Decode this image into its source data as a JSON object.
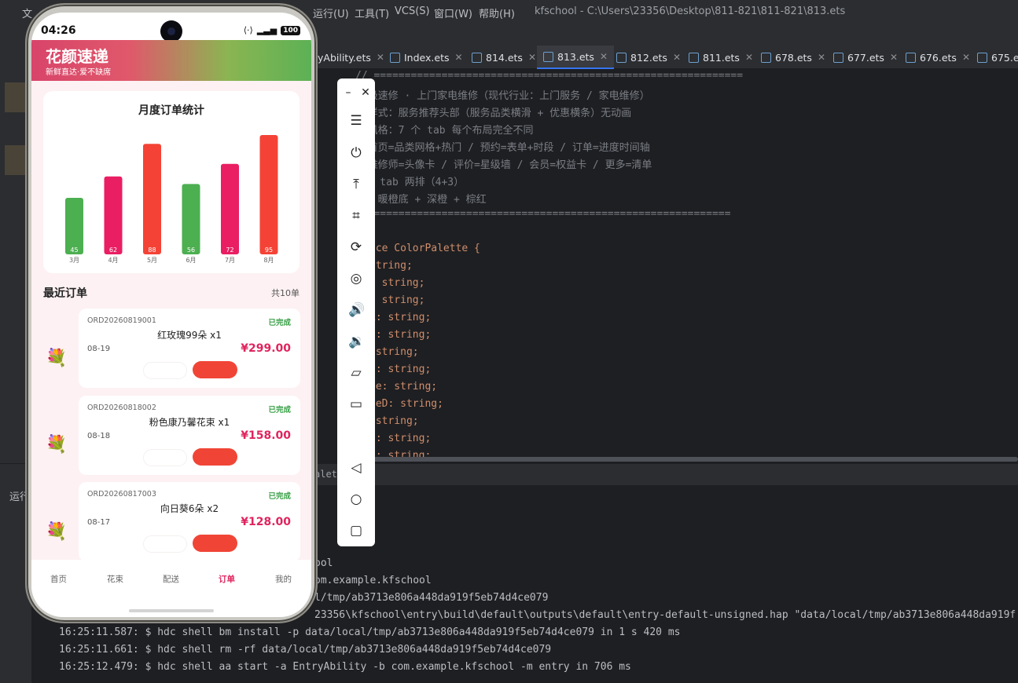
{
  "ide": {
    "menu": [
      "文",
      "运行(U)",
      "工具(T)",
      "VCS(S)",
      "窗口(W)",
      "帮助(H)"
    ],
    "title": "kfschool - C:\\Users\\23356\\Desktop\\811-821\\811-821\\813.ets",
    "tabs": [
      "yAbility.ets",
      "Index.ets",
      "814.ets",
      "813.ets",
      "812.ets",
      "811.ets",
      "678.ets",
      "677.ets",
      "676.ets",
      "675.et"
    ],
    "code_lines": [
      {
        "t": "// ============================================================",
        "c": "cmt"
      },
      {
        "t": "  极速修 · 上门家电维修（现代行业：上门服务 / 家电维修）",
        "c": "cmt"
      },
      {
        "t": "  样式：服务推荐头部（服务品类横滑 + 优惠横条）无动画",
        "c": "cmt"
      },
      {
        "t": "  风格：7 个 tab 每个布局完全不同",
        "c": "cmt"
      },
      {
        "t": "  首页=品类网格+热门 / 预约=表单+时段 / 订单=进度时间轴",
        "c": "cmt"
      },
      {
        "t": "  维修师=头像卡 / 评价=星级墙 / 会员=权益卡 / 更多=清单",
        "c": "cmt"
      },
      {
        "t": "  7 tab 两排（4+3）",
        "c": "cmt"
      },
      {
        "t": "  ：暖橙底 + 深橙 + 棕红",
        "c": "cmt"
      },
      {
        "t": "=============================================================",
        "c": "cmt"
      },
      {
        "t": "",
        "c": "id"
      },
      {
        "t": "ace ColorPalette {",
        "c": "kw"
      },
      {
        "t": "string;",
        "c": "ty"
      },
      {
        "t": ": string;",
        "c": "ty"
      },
      {
        "t": ": string;",
        "c": "ty"
      },
      {
        "t": "L: string;",
        "c": "ty"
      },
      {
        "t": "e: string;",
        "c": "ty"
      },
      {
        "t": " string;",
        "c": "ty"
      },
      {
        "t": "3: string;",
        "c": "ty"
      },
      {
        "t": "ge: string;",
        "c": "ty"
      },
      {
        "t": "geD: string;",
        "c": "ty"
      },
      {
        "t": " string;",
        "c": "ty"
      },
      {
        "t": "n: string;",
        "c": "ty"
      },
      {
        "t": "n: string;",
        "c": "ty"
      }
    ],
    "run_label": "运行",
    "editor_hint": "alette",
    "console": [
      "ool",
      "om.example.kfschool",
      "l/tmp/ab3713e806a448da919f5eb74d4ce079",
      "23356\\kfschool\\entry\\build\\default\\outputs\\default\\entry-default-unsigned.hap \"data/local/tmp/ab3713e806a448da919f",
      "16:25:11.587: $ hdc shell bm install -p data/local/tmp/ab3713e806a448da919f5eb74d4ce079 in 1 s 420 ms",
      "16:25:11.661: $ hdc shell rm -rf data/local/tmp/ab3713e806a448da919f5eb74d4ce079",
      "16:25:12.479: $ hdc shell aa start -a EntryAbility -b com.example.kfschool -m entry in 706 ms"
    ]
  },
  "phone": {
    "time": "04:26",
    "battery": "100",
    "brand": "花颜速递",
    "slogan": "新鲜直达·爱不缺席",
    "recent_title": "最近订单",
    "recent_count": "共10单",
    "orders": [
      {
        "id": "ORD20260819001",
        "status": "已完成",
        "name": "红玫瑰99朵 x1",
        "date": "08-19",
        "price": "¥299.00"
      },
      {
        "id": "ORD20260818002",
        "status": "已完成",
        "name": "粉色康乃馨花束 x1",
        "date": "08-18",
        "price": "¥158.00"
      },
      {
        "id": "ORD20260817003",
        "status": "已完成",
        "name": "向日葵6朵 x2",
        "date": "08-17",
        "price": "¥128.00"
      }
    ],
    "nav": [
      "首页",
      "花束",
      "配送",
      "订单",
      "我的"
    ],
    "nav_active": 3
  },
  "chart_data": {
    "type": "bar",
    "title": "月度订单统计",
    "categories": [
      "3月",
      "4月",
      "5月",
      "6月",
      "7月",
      "8月"
    ],
    "values": [
      45,
      62,
      88,
      56,
      72,
      95
    ],
    "colors": [
      "#4caf50",
      "#e91e63",
      "#f44336",
      "#4caf50",
      "#e91e63",
      "#f44336"
    ],
    "ylim": [
      0,
      100
    ]
  }
}
